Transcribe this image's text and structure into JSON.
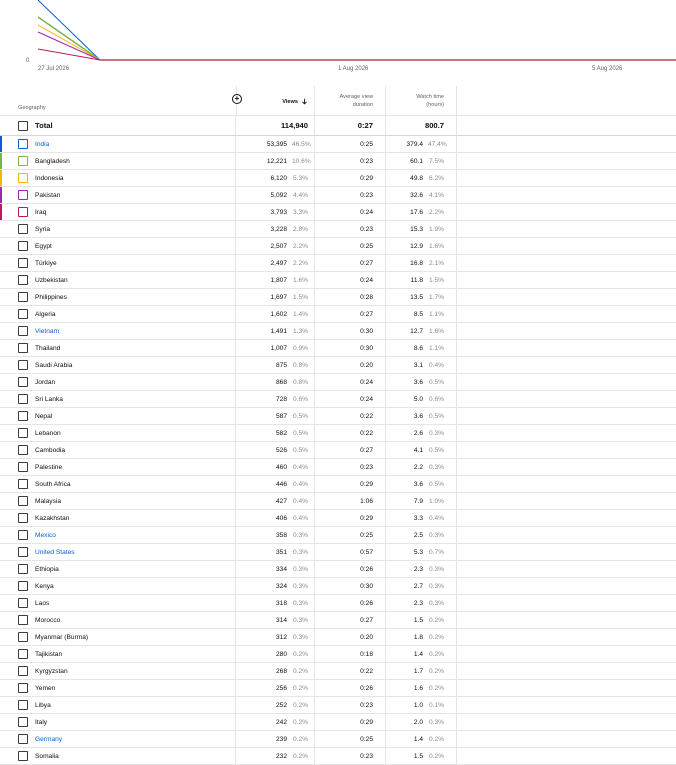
{
  "chart_data": {
    "type": "line",
    "x": [
      "27 Jul 2026",
      "1 Aug 2026",
      "5 Aug 2026"
    ],
    "ylabel_zero": "0",
    "series": [
      {
        "color": "#065fd4"
      },
      {
        "color": "#7cb342"
      },
      {
        "color": "#f4b400"
      },
      {
        "color": "#9c27b0"
      },
      {
        "color": "#c2185b"
      }
    ]
  },
  "table": {
    "headers": {
      "geography": "Geography",
      "views": "Views",
      "avg_l1": "Average view",
      "avg_l2": "duration",
      "watch_l1": "Watch time",
      "watch_l2": "(hours)",
      "add_symbol": "+"
    },
    "total": {
      "label": "Total",
      "views": "114,940",
      "avg": "0:27",
      "watch": "800.7"
    },
    "rows": [
      {
        "name": "India",
        "views": "53,395",
        "vpct": "46.5%",
        "avg": "0:25",
        "watch": "379.4",
        "wpct": "47.4%",
        "color": "#065fd4",
        "link": true
      },
      {
        "name": "Bangladesh",
        "views": "12,221",
        "vpct": "10.6%",
        "avg": "0:23",
        "watch": "60.1",
        "wpct": "7.5%",
        "color": "#7cb342",
        "link": false
      },
      {
        "name": "Indonesia",
        "views": "6,120",
        "vpct": "5.3%",
        "avg": "0:29",
        "watch": "49.8",
        "wpct": "6.2%",
        "color": "#f4b400",
        "link": false
      },
      {
        "name": "Pakistan",
        "views": "5,092",
        "vpct": "4.4%",
        "avg": "0:23",
        "watch": "32.6",
        "wpct": "4.1%",
        "color": "#9c27b0",
        "link": false
      },
      {
        "name": "Iraq",
        "views": "3,793",
        "vpct": "3.3%",
        "avg": "0:24",
        "watch": "17.6",
        "wpct": "2.2%",
        "color": "#c2185b",
        "link": false
      },
      {
        "name": "Syria",
        "views": "3,228",
        "vpct": "2.8%",
        "avg": "0:23",
        "watch": "15.3",
        "wpct": "1.9%",
        "link": false
      },
      {
        "name": "Egypt",
        "views": "2,507",
        "vpct": "2.2%",
        "avg": "0:25",
        "watch": "12.9",
        "wpct": "1.6%",
        "link": false
      },
      {
        "name": "Türkiye",
        "views": "2,497",
        "vpct": "2.2%",
        "avg": "0:27",
        "watch": "16.8",
        "wpct": "2.1%",
        "link": false
      },
      {
        "name": "Uzbekistan",
        "views": "1,807",
        "vpct": "1.6%",
        "avg": "0:24",
        "watch": "11.8",
        "wpct": "1.5%",
        "link": false
      },
      {
        "name": "Philippines",
        "views": "1,697",
        "vpct": "1.5%",
        "avg": "0:28",
        "watch": "13.5",
        "wpct": "1.7%",
        "link": false
      },
      {
        "name": "Algeria",
        "views": "1,602",
        "vpct": "1.4%",
        "avg": "0:27",
        "watch": "8.5",
        "wpct": "1.1%",
        "link": false
      },
      {
        "name": "Vietnam",
        "views": "1,491",
        "vpct": "1.3%",
        "avg": "0:30",
        "watch": "12.7",
        "wpct": "1.6%",
        "link": true
      },
      {
        "name": "Thailand",
        "views": "1,007",
        "vpct": "0.9%",
        "avg": "0:30",
        "watch": "8.6",
        "wpct": "1.1%",
        "link": false
      },
      {
        "name": "Saudi Arabia",
        "views": "875",
        "vpct": "0.8%",
        "avg": "0:20",
        "watch": "3.1",
        "wpct": "0.4%",
        "link": false
      },
      {
        "name": "Jordan",
        "views": "868",
        "vpct": "0.8%",
        "avg": "0:24",
        "watch": "3.6",
        "wpct": "0.5%",
        "link": false
      },
      {
        "name": "Sri Lanka",
        "views": "728",
        "vpct": "0.6%",
        "avg": "0:24",
        "watch": "5.0",
        "wpct": "0.6%",
        "link": false
      },
      {
        "name": "Nepal",
        "views": "587",
        "vpct": "0.5%",
        "avg": "0:22",
        "watch": "3.6",
        "wpct": "0.5%",
        "link": false
      },
      {
        "name": "Lebanon",
        "views": "582",
        "vpct": "0.5%",
        "avg": "0:22",
        "watch": "2.6",
        "wpct": "0.3%",
        "link": false
      },
      {
        "name": "Cambodia",
        "views": "526",
        "vpct": "0.5%",
        "avg": "0:27",
        "watch": "4.1",
        "wpct": "0.5%",
        "link": false
      },
      {
        "name": "Palestine",
        "views": "460",
        "vpct": "0.4%",
        "avg": "0:23",
        "watch": "2.2",
        "wpct": "0.3%",
        "link": false
      },
      {
        "name": "South Africa",
        "views": "446",
        "vpct": "0.4%",
        "avg": "0:29",
        "watch": "3.6",
        "wpct": "0.5%",
        "link": false
      },
      {
        "name": "Malaysia",
        "views": "427",
        "vpct": "0.4%",
        "avg": "1:06",
        "watch": "7.9",
        "wpct": "1.0%",
        "link": false
      },
      {
        "name": "Kazakhstan",
        "views": "406",
        "vpct": "0.4%",
        "avg": "0:29",
        "watch": "3.3",
        "wpct": "0.4%",
        "link": false
      },
      {
        "name": "Mexico",
        "views": "358",
        "vpct": "0.3%",
        "avg": "0:25",
        "watch": "2.5",
        "wpct": "0.3%",
        "link": true
      },
      {
        "name": "United States",
        "views": "351",
        "vpct": "0.3%",
        "avg": "0:57",
        "watch": "5.3",
        "wpct": "0.7%",
        "link": true
      },
      {
        "name": "Ethiopia",
        "views": "334",
        "vpct": "0.3%",
        "avg": "0:26",
        "watch": "2.3",
        "wpct": "0.3%",
        "link": false
      },
      {
        "name": "Kenya",
        "views": "324",
        "vpct": "0.3%",
        "avg": "0:30",
        "watch": "2.7",
        "wpct": "0.3%",
        "link": false
      },
      {
        "name": "Laos",
        "views": "318",
        "vpct": "0.3%",
        "avg": "0:26",
        "watch": "2.3",
        "wpct": "0.3%",
        "link": false
      },
      {
        "name": "Morocco",
        "views": "314",
        "vpct": "0.3%",
        "avg": "0:27",
        "watch": "1.5",
        "wpct": "0.2%",
        "link": false
      },
      {
        "name": "Myanmar (Burma)",
        "views": "312",
        "vpct": "0.3%",
        "avg": "0:20",
        "watch": "1.8",
        "wpct": "0.2%",
        "link": false
      },
      {
        "name": "Tajikistan",
        "views": "280",
        "vpct": "0.2%",
        "avg": "0:18",
        "watch": "1.4",
        "wpct": "0.2%",
        "link": false
      },
      {
        "name": "Kyrgyzstan",
        "views": "268",
        "vpct": "0.2%",
        "avg": "0:22",
        "watch": "1.7",
        "wpct": "0.2%",
        "link": false
      },
      {
        "name": "Yemen",
        "views": "256",
        "vpct": "0.2%",
        "avg": "0:26",
        "watch": "1.6",
        "wpct": "0.2%",
        "link": false
      },
      {
        "name": "Libya",
        "views": "252",
        "vpct": "0.2%",
        "avg": "0:23",
        "watch": "1.0",
        "wpct": "0.1%",
        "link": false
      },
      {
        "name": "Italy",
        "views": "242",
        "vpct": "0.2%",
        "avg": "0:29",
        "watch": "2.0",
        "wpct": "0.3%",
        "link": false
      },
      {
        "name": "Germany",
        "views": "239",
        "vpct": "0.2%",
        "avg": "0:25",
        "watch": "1.4",
        "wpct": "0.2%",
        "link": true
      },
      {
        "name": "Somalia",
        "views": "232",
        "vpct": "0.2%",
        "avg": "0:23",
        "watch": "1.5",
        "wpct": "0.2%",
        "link": false
      }
    ]
  }
}
